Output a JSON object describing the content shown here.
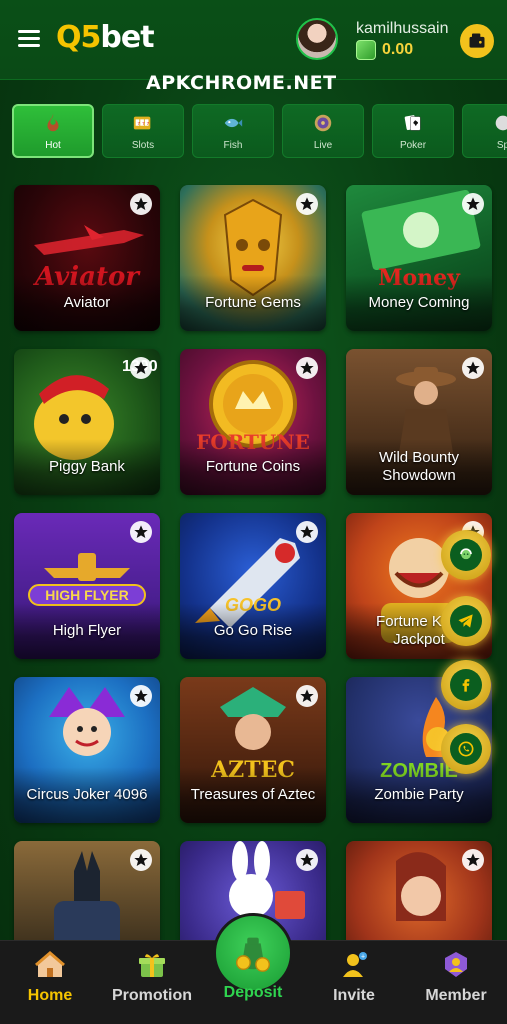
{
  "header": {
    "logo_q": "Q5",
    "logo_rest": "bet",
    "username": "kamilhussain",
    "balance": "0.00"
  },
  "watermark": "APKCHROME.NET",
  "tabs": [
    {
      "label": "Hot",
      "icon": "hot-icon",
      "active": true
    },
    {
      "label": "Slots",
      "icon": "slots-icon"
    },
    {
      "label": "Fish",
      "icon": "fish-icon"
    },
    {
      "label": "Live",
      "icon": "live-icon"
    },
    {
      "label": "Poker",
      "icon": "poker-icon"
    },
    {
      "label": "Sp",
      "icon": "sports-icon"
    }
  ],
  "games": [
    {
      "title": "Aviator"
    },
    {
      "title": "Fortune Gems"
    },
    {
      "title": "Money Coming"
    },
    {
      "title": "Piggy Bank"
    },
    {
      "title": "Fortune Coins"
    },
    {
      "title": "Wild Bounty Showdown"
    },
    {
      "title": "High Flyer"
    },
    {
      "title": "Go Go Rise"
    },
    {
      "title": "Fortune King Jackpot"
    },
    {
      "title": "Circus Joker 4096"
    },
    {
      "title": "Treasures of Aztec"
    },
    {
      "title": "Zombie Party"
    },
    {
      "title": ""
    },
    {
      "title": ""
    },
    {
      "title": ""
    }
  ],
  "float_buttons": [
    "support-icon",
    "telegram-icon",
    "facebook-icon",
    "whatsapp-icon"
  ],
  "nav": {
    "home": "Home",
    "promotion": "Promotion",
    "deposit": "Deposit",
    "invite": "Invite",
    "member": "Member"
  },
  "colors": {
    "background": "#083d12",
    "accent_gold": "#f5c400",
    "active_tab": "#2fbf3a",
    "deposit_green": "#2fd44f"
  }
}
